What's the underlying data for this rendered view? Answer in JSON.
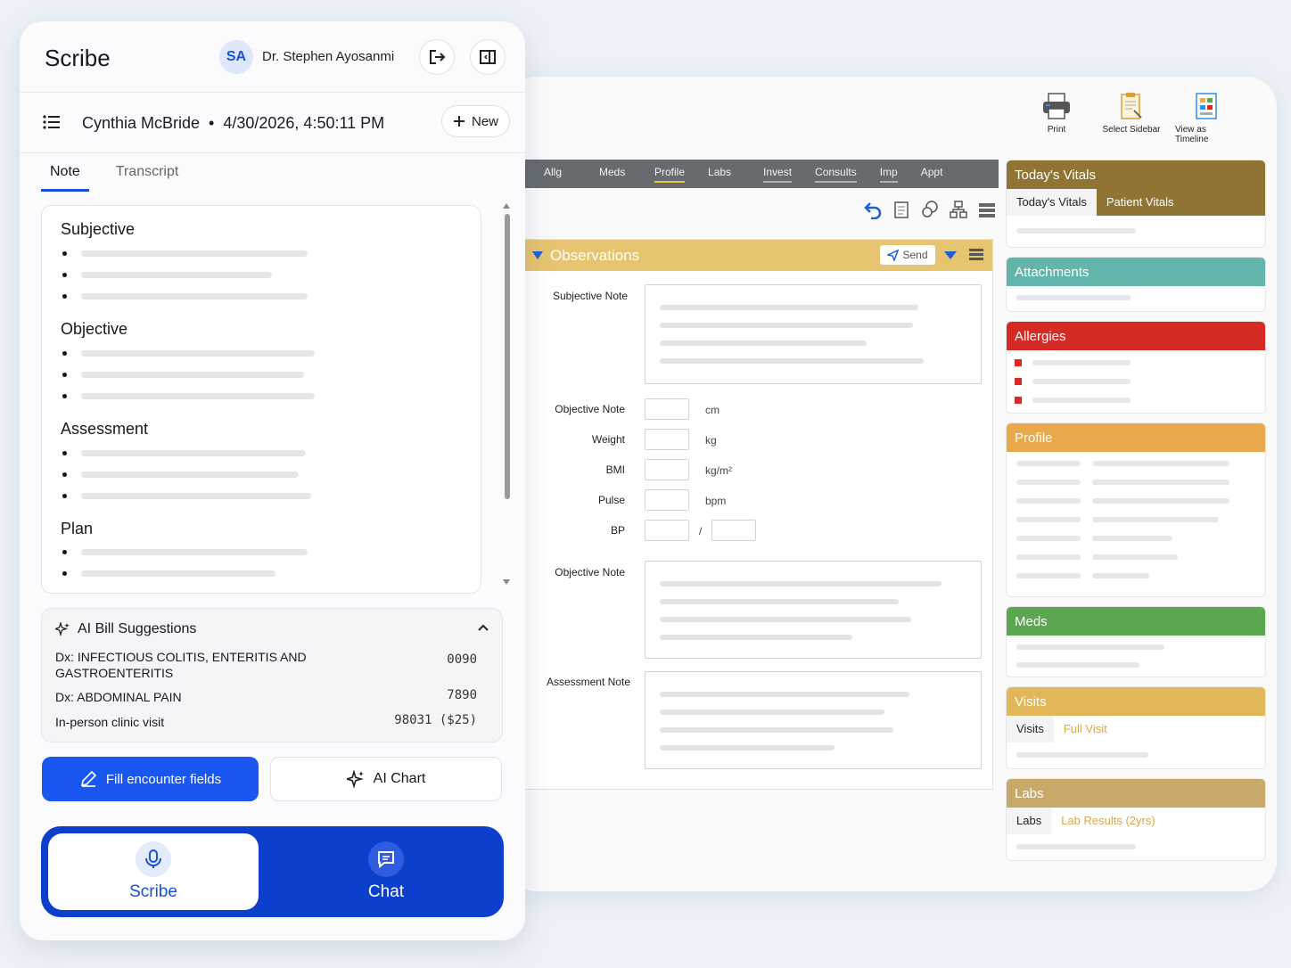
{
  "scribe": {
    "title": "Scribe",
    "avatar_initials": "SA",
    "doctor_name": "Dr. Stephen Ayosanmi",
    "patient_line": "Cynthia McBride  •  4/30/2026, 4:50:11 PM",
    "new_label": "New",
    "tabs": [
      "Note",
      "Transcript"
    ],
    "sections": [
      "Subjective",
      "Objective",
      "Assessment",
      "Plan"
    ],
    "bill": {
      "title": "AI Bill Suggestions",
      "rows": [
        {
          "label": "Dx: INFECTIOUS COLITIS, ENTERITIS AND GASTROENTERITIS",
          "code": "0090"
        },
        {
          "label": "Dx: ABDOMINAL PAIN",
          "code": "7890"
        },
        {
          "label": "In-person clinic visit",
          "code": "98031 ($25)"
        }
      ]
    },
    "fill_label": "Fill encounter fields",
    "ai_chart_label": "AI Chart",
    "modes": {
      "scribe": "Scribe",
      "chat": "Chat"
    },
    "accent": "#1a56f0"
  },
  "emr": {
    "toolbar": [
      {
        "label": "Print",
        "icon": "printer-icon"
      },
      {
        "label": "Select Sidebar",
        "icon": "clipboard-icon"
      },
      {
        "label": "View as Timeline",
        "icon": "timeline-icon"
      }
    ],
    "tabs": [
      "Allg",
      "Meds",
      "Profile",
      "Labs",
      "Invest",
      "Consults",
      "Imp",
      "Appt"
    ],
    "active_tab": "Profile",
    "observations": {
      "title": "Observations",
      "send_label": "Send",
      "subjective_label": "Subjective Note",
      "fields": [
        {
          "label": "Objective Note",
          "unit": "cm"
        },
        {
          "label": "Weight",
          "unit": "kg"
        },
        {
          "label": "BMI",
          "unit": "kg/m²"
        },
        {
          "label": "Pulse",
          "unit": "bpm"
        },
        {
          "label": "BP",
          "unit": "/"
        }
      ],
      "objective_label": "Objective Note",
      "assessment_label": "Assessment Note"
    },
    "sidebar": {
      "vitals": {
        "title": "Today's Vitals",
        "tabs": [
          "Today's Vitals",
          "Patient Vitals"
        ],
        "color": "#8f7434"
      },
      "attachments": {
        "title": "Attachments",
        "color": "#62b5ab"
      },
      "allergies": {
        "title": "Allergies",
        "color": "#d62b24"
      },
      "profile": {
        "title": "Profile",
        "color": "#e9a94a"
      },
      "meds": {
        "title": "Meds",
        "color": "#5ca551"
      },
      "visits": {
        "title": "Visits",
        "tabs": [
          "Visits",
          "Full Visit"
        ],
        "color": "#e2b75a"
      },
      "labs": {
        "title": "Labs",
        "tabs": [
          "Labs",
          "Lab Results (2yrs)"
        ],
        "color": "#c8a969"
      }
    }
  }
}
